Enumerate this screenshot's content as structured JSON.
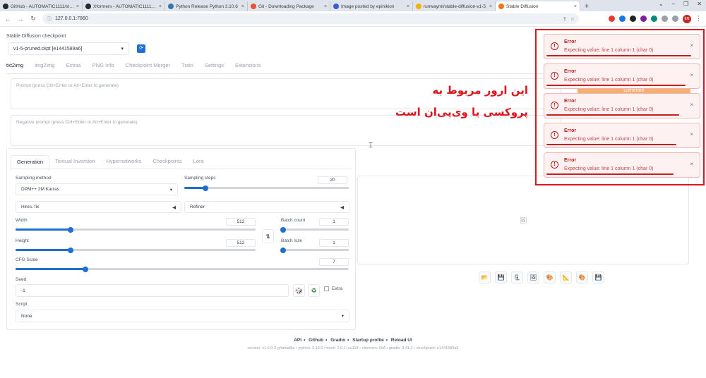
{
  "browser": {
    "tabs": [
      {
        "label": "GitHub - AUTOMATIC1111/stable",
        "favicon_color": "#24292f",
        "active": false
      },
      {
        "label": "Xformers - AUTOMATIC1111/sta",
        "favicon_color": "#24292f",
        "active": false
      },
      {
        "label": "Python Release Python 3.10.6",
        "favicon_color": "#3776ab",
        "active": false
      },
      {
        "label": "Git - Downloading Package",
        "favicon_color": "#f05033",
        "active": false
      },
      {
        "label": "Image posted by epinikion",
        "favicon_color": "#3b5bdb",
        "active": false
      },
      {
        "label": "runwayml/stable-diffusion-v1-5",
        "favicon_color": "#f5b400",
        "active": false
      },
      {
        "label": "Stable Diffusion",
        "favicon_color": "#f97316",
        "active": true
      }
    ],
    "new_tab": "+",
    "url": "127.0.0.1:7860",
    "profile_initials": "EN",
    "extension_colors": [
      "#e53935",
      "#1a73e8",
      "#222222",
      "#7b1fa2",
      "#00897b",
      "#c62828"
    ]
  },
  "checkpoint": {
    "label": "Stable Diffusion checkpoint",
    "value": "v1-5-pruned.ckpt [e1441589a6]"
  },
  "main_tabs": [
    "txt2img",
    "img2img",
    "Extras",
    "PNG Info",
    "Checkpoint Merger",
    "Train",
    "Settings",
    "Extensions"
  ],
  "prompt": {
    "positive_placeholder": "Prompt (press Ctrl+Enter or Alt+Enter to generate)",
    "negative_placeholder": "Negative prompt (press Ctrl+Enter or Alt+Enter to generate)"
  },
  "generate_label": "Generate",
  "annotation": {
    "line1": "این ارور مربوط به",
    "line2": "پروکسی یا وی‌پی‌ان است",
    "color": "#e0141c"
  },
  "sub_tabs": [
    "Generation",
    "Textual Inversion",
    "Hypernetworks",
    "Checkpoints",
    "Lora"
  ],
  "generation": {
    "sampling_method_label": "Sampling method",
    "sampling_method_value": "DPM++ 2M Karras",
    "sampling_steps_label": "Sampling steps",
    "sampling_steps_value": "20",
    "hires_label": "Hires. fix",
    "refiner_label": "Refiner",
    "width_label": "Width",
    "width_value": "512",
    "height_label": "Height",
    "height_value": "512",
    "batch_count_label": "Batch count",
    "batch_count_value": "1",
    "batch_size_label": "Batch size",
    "batch_size_value": "1",
    "cfg_label": "CFG Scale",
    "cfg_value": "7",
    "seed_label": "Seed",
    "seed_value": "-1",
    "extra_label": "Extra",
    "script_label": "Script",
    "script_value": "None"
  },
  "sliders": {
    "sampling_steps_fraction": 0.13,
    "width_fraction": 0.23,
    "height_fraction": 0.23,
    "batch_count_fraction": 0.0,
    "batch_size_fraction": 0.0,
    "cfg_fraction": 0.21
  },
  "footer": {
    "links": [
      "API",
      "Github",
      "Gradio",
      "Startup profile",
      "Reload UI"
    ],
    "version": "version: v1.6.0-2-g4afaaf8a  •  python: 3.10.6  •  torch: 2.0.1+cu118  •  xformers: N/A  •  gradio: 3.41.2  •  checkpoint: e1441589a6"
  },
  "errors": [
    {
      "title": "Error",
      "message": "Expecting value: line 1 column 1 (char 0)",
      "progress": 0.96
    },
    {
      "title": "Error",
      "message": "Expecting value: line 1 column 1 (char 0)",
      "progress": 0.92
    },
    {
      "title": "Error",
      "message": "Expecting value: line 1 column 1 (char 0)",
      "progress": 0.88
    },
    {
      "title": "Error",
      "message": "Expecting value: line 1 column 1 (char 0)",
      "progress": 0.86
    },
    {
      "title": "Error",
      "message": "Expecting value: line 1 column 1 (char 0)",
      "progress": 0.84
    }
  ],
  "error_color": "#b91c1c"
}
